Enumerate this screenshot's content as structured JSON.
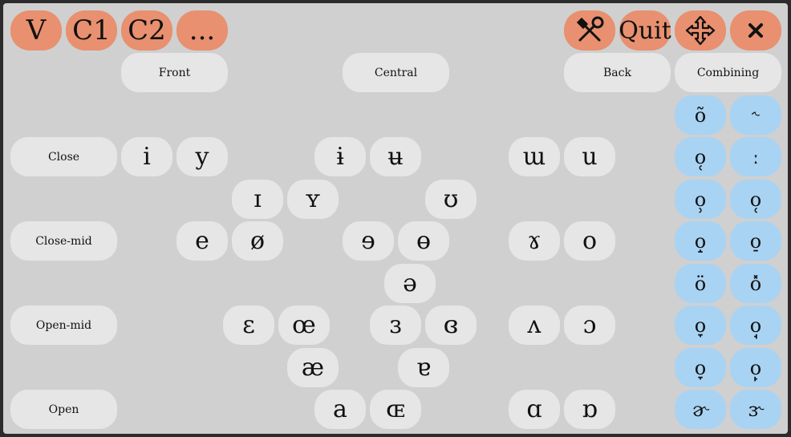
{
  "toolbar": {
    "tabs": [
      "V",
      "C1",
      "C2",
      "..."
    ],
    "quit_label": "Quit",
    "icons": [
      "tools-icon",
      "move-icon",
      "close-icon"
    ]
  },
  "columns": {
    "front": "Front",
    "central": "Central",
    "back": "Back",
    "combining": "Combining"
  },
  "rows": {
    "close": "Close",
    "close_mid": "Close-mid",
    "open_mid": "Open-mid",
    "open": "Open"
  },
  "vowels": {
    "i": "i",
    "y": "y",
    "barred_i": "ɨ",
    "barred_u": "ʉ",
    "turned_m": "ɯ",
    "u": "u",
    "small_cap_i": "ɪ",
    "small_cap_y": "ʏ",
    "upsilon": "ʊ",
    "e": "e",
    "o_slash": "ø",
    "reversed_e": "ɘ",
    "barred_o": "ɵ",
    "rams_horn": "ɤ",
    "o": "o",
    "schwa": "ə",
    "open_e": "ɛ",
    "oe": "œ",
    "reversed_open_e": "ɜ",
    "closed_rev_open_e": "ɞ",
    "turned_v": "ʌ",
    "open_o": "ɔ",
    "ae": "æ",
    "turned_a": "ɐ",
    "a": "a",
    "small_cap_oe": "ɶ",
    "script_a": "ɑ",
    "turned_script_a": "ɒ"
  },
  "combining": [
    "õ",
    "˞",
    "o̜",
    "ː",
    "o̹",
    "o̜",
    "o̝",
    "o̠",
    "ö",
    "o̽",
    "o̞",
    "o̘",
    "o̞",
    "o̙",
    "ɚ",
    "ɝ"
  ],
  "colors": {
    "orange": "#e8906f",
    "gray_button": "#e6e6e6",
    "blue_button": "#a9d3f2",
    "background": "#d0d0d0"
  }
}
